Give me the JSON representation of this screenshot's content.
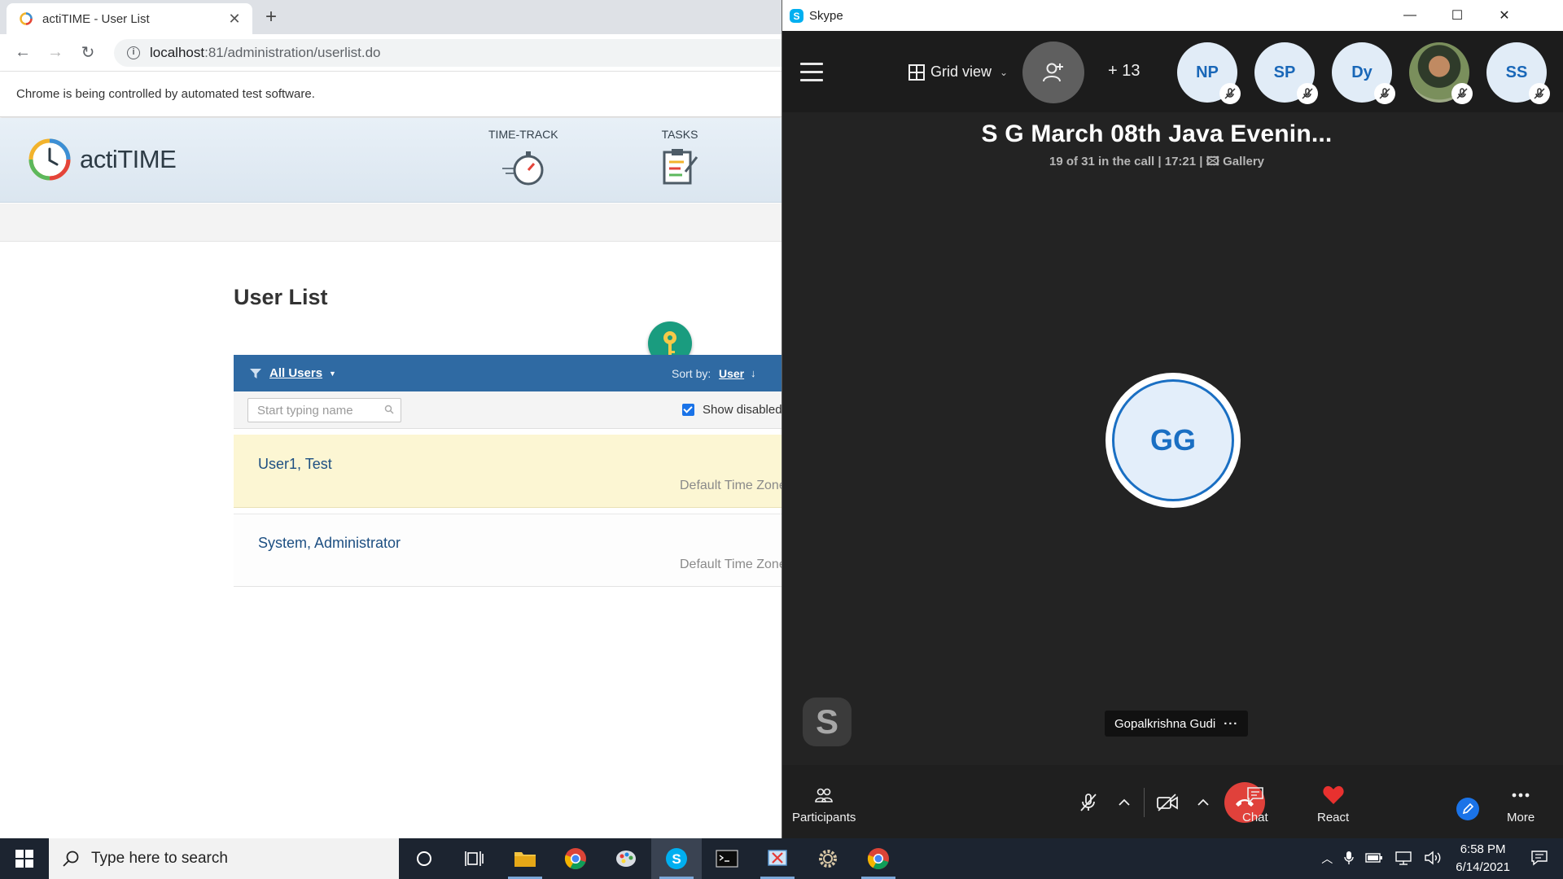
{
  "chrome": {
    "tab_title": "actiTIME - User List",
    "url_host": "localhost",
    "url_rest": ":81/administration/userlist.do",
    "infobar_text": "Chrome is being controlled by automated test software."
  },
  "actitime": {
    "logo_text": "actiTIME",
    "modules": [
      {
        "label": "TIME-TRACK"
      },
      {
        "label": "TASKS"
      }
    ],
    "page_title": "User List",
    "filter_label": "All Users",
    "sort_by_label": "Sort by:",
    "sort_value": "User",
    "search_placeholder": "Start typing name",
    "show_disabled_label": "Show disabled",
    "users": [
      {
        "name": "User1, Test",
        "timezone": "Default Time Zone"
      },
      {
        "name": "System, Administrator",
        "timezone": "Default Time Zone"
      }
    ]
  },
  "skype": {
    "window_title": "Skype",
    "view_mode": "Grid view",
    "extra_participants": "+ 13",
    "participant_avatars": [
      {
        "initials": "NP"
      },
      {
        "initials": "SP"
      },
      {
        "initials": "Dy"
      },
      {
        "initials": ""
      },
      {
        "initials": "SS"
      }
    ],
    "meeting_title": "S G March 08th Java Evenin...",
    "call_status": "19 of 31 in the call | 17:21 | ",
    "view_label": "Gallery",
    "speaker_initials": "GG",
    "self_initial": "S",
    "speaker_name": "Gopalkrishna Gudi",
    "bottom_bar": {
      "participants": "Participants",
      "chat": "Chat",
      "react": "React",
      "more": "More"
    }
  },
  "taskbar": {
    "search_placeholder": "Type here to search",
    "time": "6:58 PM",
    "date": "6/14/2021"
  },
  "colors": {
    "actitime_bar": "#2f6aa3",
    "skype_blue": "#1a6fc3",
    "hangup_red": "#e0413b",
    "selected_row": "#fcf6d3"
  }
}
